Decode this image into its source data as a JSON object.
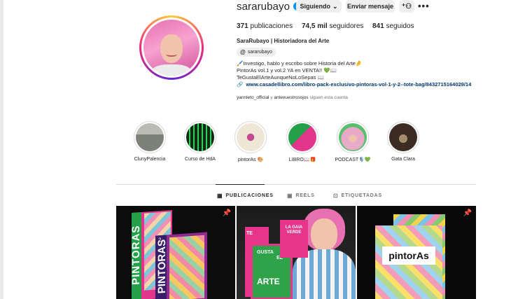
{
  "profile": {
    "username": "sararubayo",
    "verified_icon": "verified-badge-icon",
    "buttons": {
      "following": "Siguiendo",
      "following_caret": "⌄",
      "message": "Enviar mensaje",
      "add_user_icon": "add-user-icon",
      "more_icon": "more-options-icon"
    },
    "stats": {
      "posts_num": "371",
      "posts_label": "publicaciones",
      "followers_num": "74,5 mil",
      "followers_label": "seguidores",
      "following_num": "841",
      "following_label": "seguidos"
    },
    "full_name": "SaraRubayo | Historiadora del Arte",
    "threads_handle": "sararubayo",
    "bio_lines": [
      "🖌️Investigo, hablo y escribo sobre Historia del Arte🤌",
      "PintorAs vol.1 y vol.2 YA en VENTA!! 💚📖",
      "TeGustaElArteAunqueNoLoSepas 📖"
    ],
    "link": "www.casadellibro.com/libro-pack-exclusivo-pintoras-vol-1-y-2--tote-bag/8432715164029/14",
    "followed_by": {
      "users": "yannleto_official",
      "and": "y",
      "others": "antevuestrosojos",
      "suffix": "siguen esta cuenta"
    }
  },
  "highlights": [
    {
      "label": "ClunyPalencia",
      "colors": [
        "#8a8f87",
        "#c9c9c4"
      ]
    },
    {
      "label": "Curso de HdA",
      "colors": [
        "#0f2a13",
        "#2fd15b"
      ]
    },
    {
      "label": "pintorAs 🎨",
      "colors": [
        "#efe7d6",
        "#c34a8f"
      ]
    },
    {
      "label": "LIBRO📖🎁",
      "colors": [
        "#24a04a",
        "#e1368b"
      ]
    },
    {
      "label": "PODCAST🎙️💚",
      "colors": [
        "#e9a9c8",
        "#5bbf70"
      ]
    },
    {
      "label": "Gata Clara",
      "colors": [
        "#3b2b22",
        "#a48b6d"
      ]
    }
  ],
  "tabs": [
    {
      "label": "PUBLICACIONES",
      "icon": "grid-icon",
      "active": true
    },
    {
      "label": "REELS",
      "icon": "reels-icon",
      "active": false
    },
    {
      "label": "ETIQUETADAS",
      "icon": "tagged-icon",
      "active": false
    }
  ],
  "posts": [
    {
      "type": "book-covers",
      "pinned": true,
      "book_text": "PINTORAS",
      "vol_label": "2"
    },
    {
      "type": "book-author",
      "pinned": false,
      "book_text_1": "TE",
      "book_text_2": "GUSTA",
      "book_text_3": "EL",
      "book_text_4": "ARTE",
      "book_subtitle": "LA GAIA VERDE"
    },
    {
      "type": "box",
      "pinned": true,
      "box_text": "pintorAs"
    }
  ],
  "colors": {
    "accent_blue": "#0095f6",
    "link_blue": "#00376b",
    "button_gray": "#efefef"
  }
}
